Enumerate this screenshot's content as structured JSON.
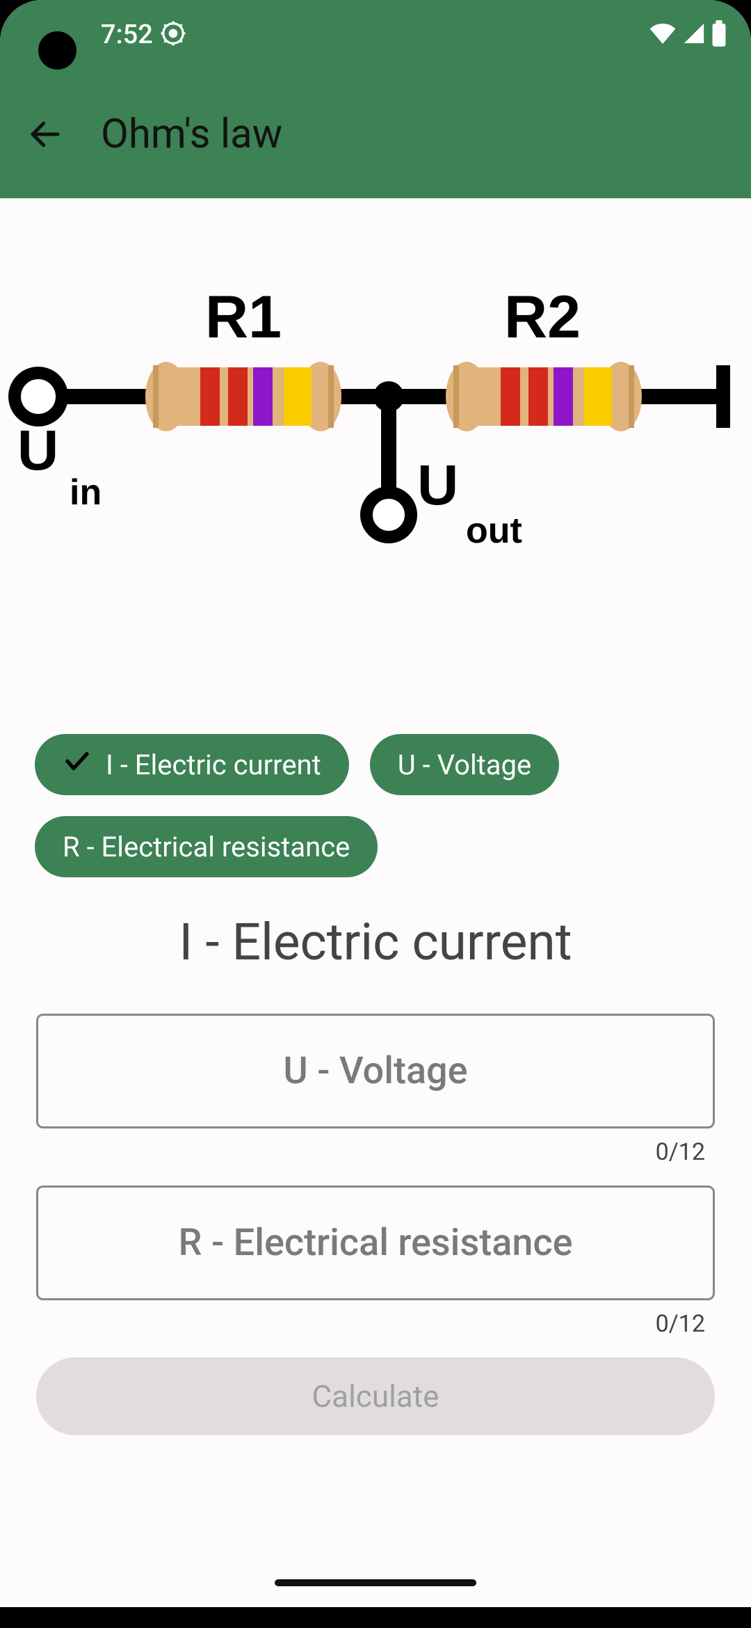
{
  "status": {
    "time": "7:52"
  },
  "header": {
    "title": "Ohm's law"
  },
  "diagram": {
    "r1_label": "R1",
    "r2_label": "R2",
    "uin_prefix": "U",
    "uin_suffix": "in",
    "uout_prefix": "U",
    "uout_suffix": "out"
  },
  "chips": {
    "items": [
      {
        "label": "I - Electric current",
        "selected": true
      },
      {
        "label": "U - Voltage",
        "selected": false
      },
      {
        "label": "R - Electrical resistance",
        "selected": false
      }
    ]
  },
  "selected_title": "I - Electric current",
  "inputs": {
    "voltage": {
      "placeholder": "U - Voltage",
      "count": "0/12"
    },
    "resistance": {
      "placeholder": "R - Electrical resistance",
      "count": "0/12"
    }
  },
  "button": {
    "calculate": "Calculate"
  },
  "colors": {
    "primary": "#3c8254"
  }
}
